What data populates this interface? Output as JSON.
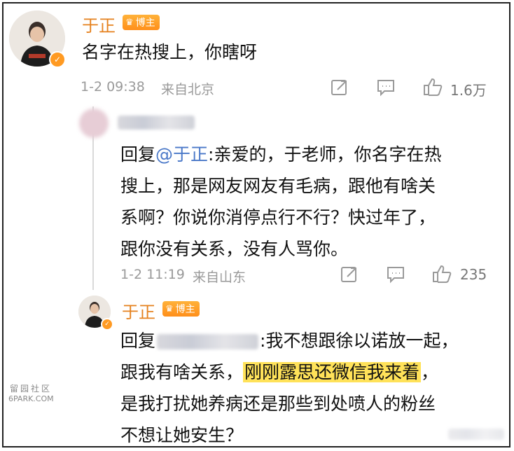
{
  "post": {
    "user_name": "于正",
    "badge": "博主",
    "text": "名字在热搜上，你瞎呀",
    "time": "1-2 09:38",
    "location": "来自北京",
    "likes": "1.6万"
  },
  "reply1": {
    "prefix": "回复",
    "mention": "@于正",
    "line1": ":亲爱的，于老师，你名字在热",
    "line2": "搜上，那是网友网友有毛病，跟他有啥关",
    "line3": "系啊？你说你消停点行不行？快过年了，",
    "line4": "跟你没有关系，没有人骂你。",
    "time": "1-2 11:19",
    "location": "来自山东",
    "likes": "235"
  },
  "reply2": {
    "user_name": "于正",
    "badge": "博主",
    "prefix": "回复",
    "line1_rest": ":我不想跟徐以诺放一起，",
    "line2_a": "跟我有啥关系，",
    "line2_highlight": "刚刚露思还微信我来着",
    "line2_b": "，",
    "line3": "是我打扰她养病还是那些到处喷人的粉丝",
    "line4": "不想让她安生？"
  },
  "watermark": {
    "cn": "留园社区",
    "en": "6PARK.COM"
  },
  "colors": {
    "name": "#e5821f",
    "badge": "#ff9a22",
    "mention": "#4a78c8",
    "highlight": "#ffe259",
    "meta": "#9a9a9a"
  },
  "icons": [
    "share-icon",
    "comment-icon",
    "like-icon",
    "verified-icon",
    "crown-icon"
  ]
}
